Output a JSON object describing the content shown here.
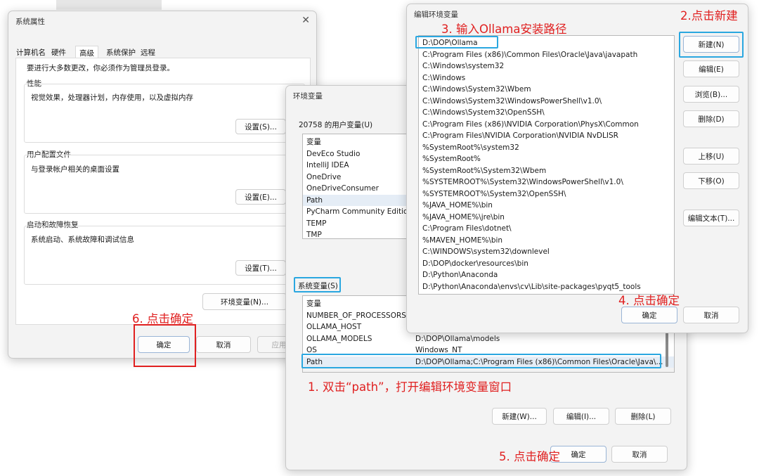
{
  "annotations": {
    "a1": "1. 双击“path”，打开编辑环境变量窗口",
    "a2": "2.点击新建",
    "a3": "3. 输入Ollama安装路径",
    "a4": "4. 点击确定",
    "a5": "5. 点击确定",
    "a6": "6. 点击确定"
  },
  "sysprops": {
    "title": "系统属性",
    "tabs": [
      "计算机名",
      "硬件",
      "高级",
      "系统保护",
      "远程"
    ],
    "admin_note": "要进行大多数更改，你必须作为管理员登录。",
    "perf": {
      "heading": "性能",
      "desc": "视觉效果，处理器计划，内存使用，以及虚拟内存",
      "btn": "设置(S)..."
    },
    "profile": {
      "heading": "用户配置文件",
      "desc": "与登录帐户相关的桌面设置",
      "btn": "设置(E)..."
    },
    "startup": {
      "heading": "启动和故障恢复",
      "desc": "系统启动、系统故障和调试信息",
      "btn": "设置(T)..."
    },
    "envvars_btn": "环境变量(N)...",
    "ok": "确定",
    "cancel": "取消",
    "apply": "应用"
  },
  "envvars": {
    "title": "环境变量",
    "user_heading": "20758 的用户变量(U)",
    "user_col": "变量",
    "user_vars": [
      "DevEco Studio",
      "IntelliJ IDEA",
      "OneDrive",
      "OneDriveConsumer",
      "Path",
      "PyCharm Community Edition",
      "TEMP",
      "TMP"
    ],
    "sys_heading": "系统变量(S)",
    "sys_col": "变量",
    "sys_vars": [
      {
        "name": "NUMBER_OF_PROCESSORS",
        "value": ""
      },
      {
        "name": "OLLAMA_HOST",
        "value": ""
      },
      {
        "name": "OLLAMA_MODELS",
        "value": "D:\\DOP\\Ollama\\models"
      },
      {
        "name": "OS",
        "value": "Windows_NT"
      },
      {
        "name": "Path",
        "value": "D:\\DOP\\Ollama;C:\\Program Files (x86)\\Common Files\\Oracle\\Java\\..."
      }
    ],
    "new_btn": "新建(W)...",
    "edit_btn": "编辑(I)...",
    "delete_btn": "删除(L)",
    "ok": "确定",
    "cancel": "取消"
  },
  "editenv": {
    "title": "编辑环境变量",
    "entries": [
      "D:\\DOP\\Ollama",
      "C:\\Program Files (x86)\\Common Files\\Oracle\\Java\\javapath",
      "C:\\Windows\\system32",
      "C:\\Windows",
      "C:\\Windows\\System32\\Wbem",
      "C:\\Windows\\System32\\WindowsPowerShell\\v1.0\\",
      "C:\\Windows\\System32\\OpenSSH\\",
      "C:\\Program Files (x86)\\NVIDIA Corporation\\PhysX\\Common",
      "C:\\Program Files\\NVIDIA Corporation\\NVIDIA NvDLISR",
      "%SystemRoot%\\system32",
      "%SystemRoot%",
      "%SystemRoot%\\System32\\Wbem",
      "%SYSTEMROOT%\\System32\\WindowsPowerShell\\v1.0\\",
      "%SYSTEMROOT%\\System32\\OpenSSH\\",
      "%JAVA_HOME%\\bin",
      "%JAVA_HOME%\\jre\\bin",
      "C:\\Program Files\\dotnet\\",
      "%MAVEN_HOME%\\bin",
      "C:\\WINDOWS\\system32\\downlevel",
      "D:\\DOP\\docker\\resources\\bin",
      "D:\\Python\\Anaconda",
      "D:\\Python\\Anaconda\\envs\\cv\\Lib\\site-packages\\pyqt5_tools"
    ],
    "new_btn": "新建(N)",
    "edit_btn": "编辑(E)",
    "browse_btn": "浏览(B)...",
    "delete_btn": "删除(D)",
    "up_btn": "上移(U)",
    "down_btn": "下移(O)",
    "edittext_btn": "编辑文本(T)...",
    "ok": "确定",
    "cancel": "取消"
  }
}
